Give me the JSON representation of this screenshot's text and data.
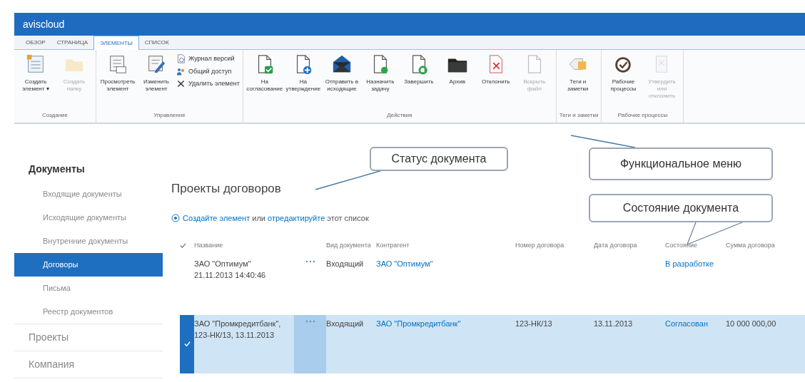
{
  "app_bar": {
    "title": "aviscloud"
  },
  "tabs": [
    {
      "label": "ОБЗОР",
      "selected": false
    },
    {
      "label": "СТРАНИЦА",
      "selected": false
    },
    {
      "label": "ЭЛЕМЕНТЫ",
      "selected": true
    },
    {
      "label": "СПИСОК",
      "selected": false
    }
  ],
  "ribbon": [
    {
      "group": "Создание",
      "buttons": [
        {
          "kind": "new-item",
          "label": "Создать элемент ▾",
          "disabled": false
        },
        {
          "kind": "folder",
          "label": "Создать папку",
          "disabled": true
        }
      ]
    },
    {
      "group": "Управление",
      "buttons": [
        {
          "kind": "view",
          "label": "Просмотреть элемент",
          "disabled": false
        },
        {
          "kind": "edit",
          "label": "Изменить элемент",
          "disabled": false
        }
      ],
      "small_buttons": [
        {
          "kind": "history",
          "label": "Журнал версий"
        },
        {
          "kind": "share",
          "label": "Общий доступ"
        },
        {
          "kind": "delete",
          "label": "Удалить элемент"
        }
      ]
    },
    {
      "group": "Действия",
      "buttons": [
        {
          "kind": "doc-check",
          "label": "На согласование",
          "disabled": false
        },
        {
          "kind": "doc-plus",
          "label": "На утверждение",
          "disabled": false
        },
        {
          "kind": "mail",
          "label": "Отправить в исходящие",
          "disabled": false
        },
        {
          "kind": "doc-task",
          "label": "Назначить задачу",
          "disabled": false
        },
        {
          "kind": "doc-done",
          "label": "Завершить",
          "disabled": false
        },
        {
          "kind": "archive",
          "label": "Архив",
          "disabled": false
        },
        {
          "kind": "doc-reject",
          "label": "Отклонить",
          "disabled": false
        },
        {
          "kind": "doc-blank",
          "label": "Вскрыть файл",
          "disabled": true
        }
      ]
    },
    {
      "group": "Теги и заметки",
      "buttons": [
        {
          "kind": "tag",
          "label": "Теги и заметки",
          "disabled": false
        }
      ]
    },
    {
      "group": "Рабочие процессы",
      "buttons": [
        {
          "kind": "workflow",
          "label": "Рабочие процессы",
          "disabled": false
        },
        {
          "kind": "approve",
          "label": "Утвердить или отклонить",
          "disabled": true
        }
      ]
    }
  ],
  "sidebar": {
    "items": [
      {
        "label": "Документы",
        "selected": false,
        "children": [
          {
            "label": "Входящие документы",
            "selected": false
          },
          {
            "label": "Исходящие документы",
            "selected": false
          },
          {
            "label": "Внутренние документы",
            "selected": false
          },
          {
            "label": "Договоры",
            "selected": true
          },
          {
            "label": "Письма",
            "selected": false
          },
          {
            "label": "Реестр документов",
            "selected": false
          }
        ]
      },
      {
        "label": "Проекты",
        "selected": false
      },
      {
        "label": "Компания",
        "selected": false
      }
    ]
  },
  "list": {
    "title": "Проекты договоров",
    "create_line": [
      {
        "text": "Создайте элемент",
        "link": true
      },
      {
        "text": "или",
        "link": false
      },
      {
        "text": "отредактируйте",
        "link": true
      },
      {
        "text": "этот список",
        "link": false
      }
    ],
    "columns": [
      "Название",
      "Вид документа",
      "Контрагент",
      "Номер договора",
      "Дата договора",
      "Состояние",
      "Сумма договора"
    ],
    "rows": [
      {
        "selected": false,
        "name": "ЗАО \"Оптимум\" 21.11.2013 14:40:46",
        "doc_type": "Входящий",
        "counterparty": "ЗАО \"Оптимум\"",
        "state": "В разработке"
      },
      {
        "selected": true,
        "name": "ЗАО \"Промкредитбанк\", 123-НК/13, 13.11.2013",
        "doc_type": "Входящий",
        "counterparty": "ЗАО \"Промкредитбанк\"",
        "number": "123-НК/13",
        "date": "13.11.2013",
        "state": "Согласован",
        "amount": "10 000 000,00"
      }
    ]
  },
  "callouts": [
    {
      "text": "Статус документа"
    },
    {
      "text": "Функциональное меню"
    },
    {
      "text": "Состояние документа"
    }
  ]
}
